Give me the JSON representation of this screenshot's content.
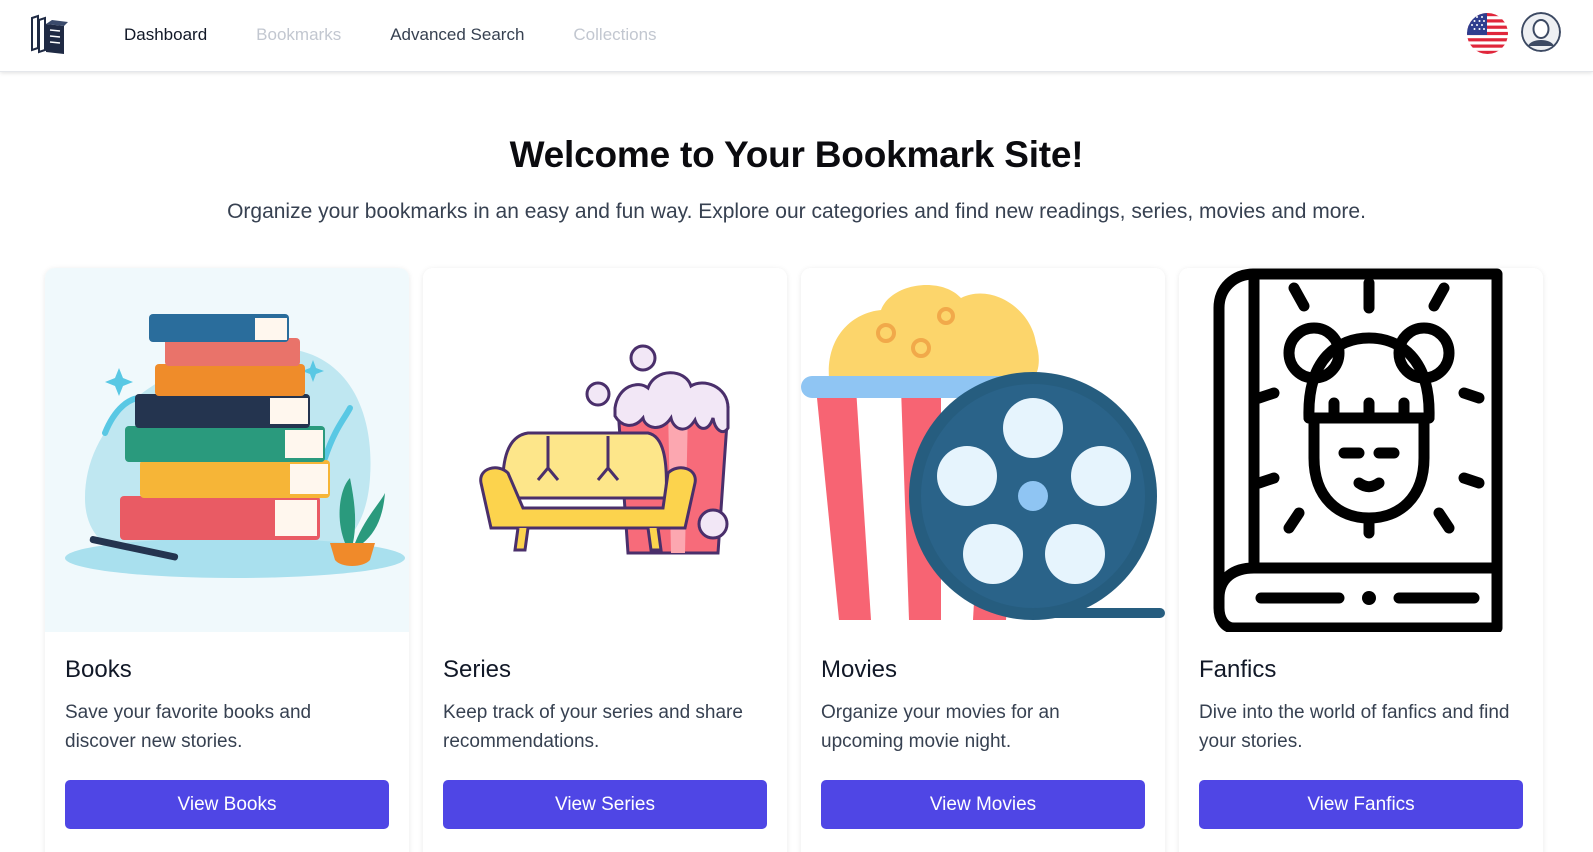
{
  "nav": {
    "logo_icon": "books-stack-icon",
    "links": [
      {
        "label": "Dashboard",
        "state": "active"
      },
      {
        "label": "Bookmarks",
        "state": "disabled"
      },
      {
        "label": "Advanced Search",
        "state": "normal"
      },
      {
        "label": "Collections",
        "state": "disabled"
      }
    ],
    "language_icon": "us-flag-icon",
    "avatar_icon": "user-avatar-icon"
  },
  "hero": {
    "title": "Welcome to Your Bookmark Site!",
    "subtitle": "Organize your bookmarks in an easy and fun way. Explore our categories and find new readings, series, movies and more."
  },
  "cards": [
    {
      "title": "Books",
      "description": "Save your favorite books and discover new stories.",
      "button": "View Books",
      "image_icon": "book-stack-illustration"
    },
    {
      "title": "Series",
      "description": "Keep track of your series and share recommendations.",
      "button": "View Series",
      "image_icon": "sofa-popcorn-illustration"
    },
    {
      "title": "Movies",
      "description": "Organize your movies for an upcoming movie night.",
      "button": "View Movies",
      "image_icon": "popcorn-film-reel-illustration"
    },
    {
      "title": "Fanfics",
      "description": "Dive into the world of fanfics and find your stories.",
      "button": "View Fanfics",
      "image_icon": "fanfic-book-icon"
    }
  ],
  "colors": {
    "primary_button": "#4f46e5",
    "muted_nav": "#c2c7d0"
  }
}
